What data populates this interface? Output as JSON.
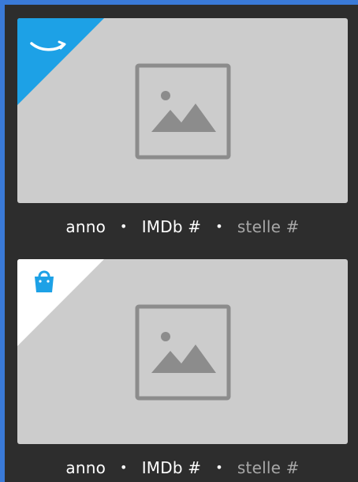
{
  "cards": [
    {
      "badge": "amazon-icon",
      "meta": {
        "year": "anno",
        "sep1": "•",
        "imdb": "IMDb #",
        "sep2": "•",
        "stars": "stelle #"
      }
    },
    {
      "badge": "shopping-bag-icon",
      "meta": {
        "year": "anno",
        "sep1": "•",
        "imdb": "IMDb #",
        "sep2": "•",
        "stars": "stelle #"
      }
    }
  ],
  "colors": {
    "background": "#2d2d2d",
    "thumbnail": "#cccccc",
    "amazon_corner": "#1da1e6",
    "shop_corner": "#ffffff",
    "shop_icon": "#1da1e6",
    "muted_text": "#a8a8a8"
  }
}
